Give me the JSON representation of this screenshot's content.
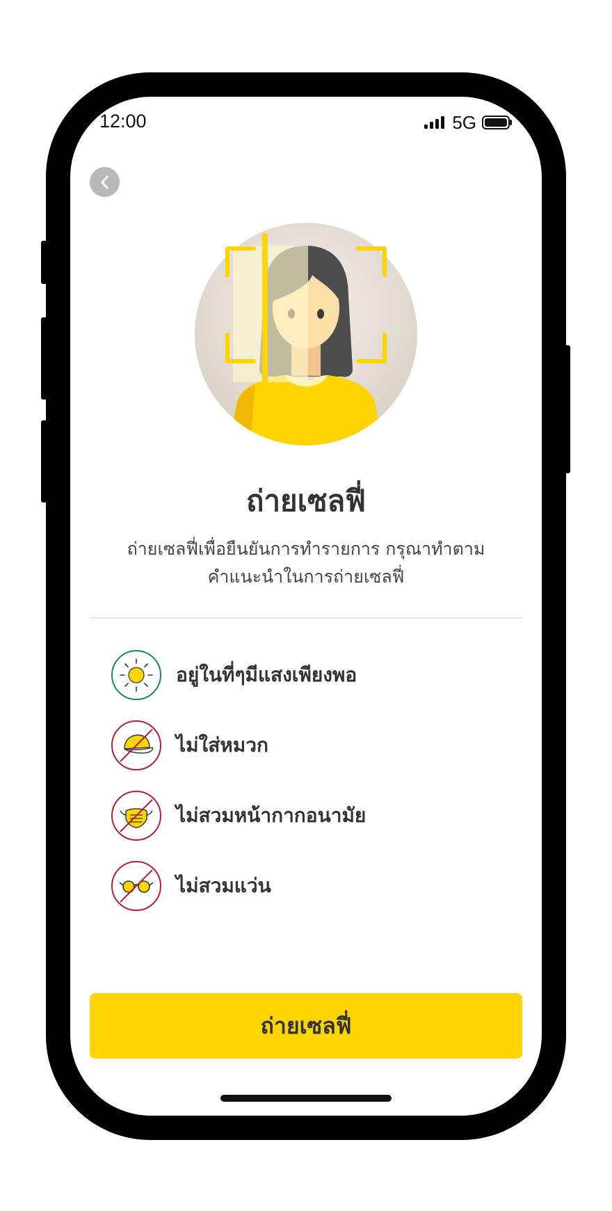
{
  "status_bar": {
    "time": "12:00",
    "network": "5G"
  },
  "header": {
    "back_icon": "chevron-left-icon"
  },
  "intro": {
    "title": "ถ่ายเซลฟี่",
    "description_line1": "ถ่ายเซลฟี่เพื่อยืนยันการทำรายการ กรุณาทำตาม",
    "description_line2": "คำแนะนำในการถ่ายเซลฟี่"
  },
  "guidelines": [
    {
      "label": "อยู่ในที่ๆมีแสงเพียงพอ",
      "icon": "sun-icon",
      "status": "do",
      "color": "#1a8a5a"
    },
    {
      "label": "ไม่ใส่หมวก",
      "icon": "no-hat-icon",
      "status": "dont",
      "color": "#b0203c"
    },
    {
      "label": "ไม่สวมหน้ากากอนามัย",
      "icon": "no-mask-icon",
      "status": "dont",
      "color": "#b0203c"
    },
    {
      "label": "ไม่สวมแว่น",
      "icon": "no-glasses-icon",
      "status": "dont",
      "color": "#b0203c"
    }
  ],
  "actions": {
    "primary_label": "ถ่ายเซลฟี่"
  },
  "colors": {
    "accent": "#ffd500",
    "text": "#333333",
    "ok": "#1a8a5a",
    "prohibited": "#b0203c"
  }
}
